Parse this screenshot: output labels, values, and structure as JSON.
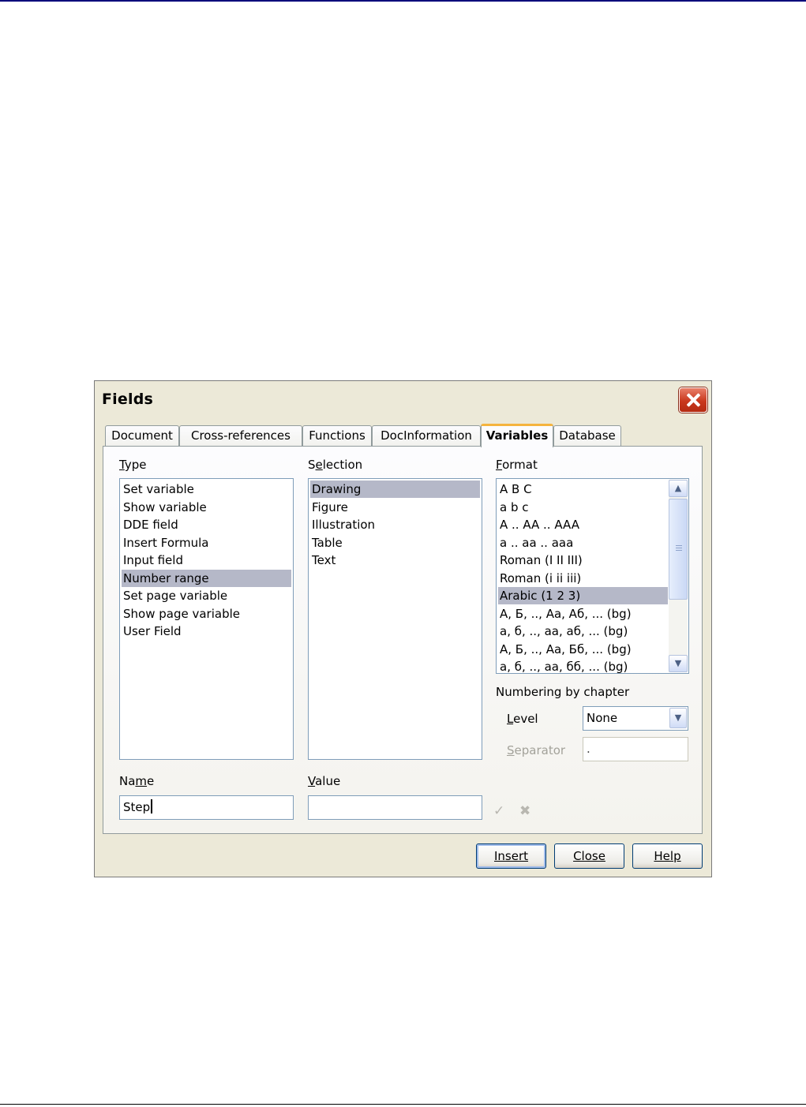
{
  "dialog": {
    "title": "Fields",
    "tabs": [
      {
        "label": "Document"
      },
      {
        "label": "Cross-references"
      },
      {
        "label": "Functions"
      },
      {
        "label": "DocInformation"
      },
      {
        "label": "Variables"
      },
      {
        "label": "Database"
      }
    ],
    "active_tab": "Variables",
    "type": {
      "label": "Type",
      "items": [
        "Set variable",
        "Show variable",
        "DDE field",
        "Insert Formula",
        "Input field",
        "Number range",
        "Set page variable",
        "Show page variable",
        "User Field"
      ],
      "selected": "Number range"
    },
    "selection": {
      "label": "Selection",
      "items": [
        "Drawing",
        "Figure",
        "Illustration",
        "Table",
        "Text"
      ],
      "selected": "Drawing"
    },
    "format": {
      "label": "Format",
      "items": [
        "A B C",
        "a b c",
        "A .. AA .. AAA",
        "a .. aa .. aaa",
        "Roman (I II III)",
        "Roman (i ii iii)",
        "Arabic (1 2 3)",
        "А, Б, .., Аа, Аб, ... (bg)",
        "а, б, .., аа, аб, ... (bg)",
        "А, Б, .., Аа, Бб, ... (bg)",
        "а, б, .., аа, бб, ... (bg)"
      ],
      "selected": "Arabic (1 2 3)"
    },
    "numbering_by_chapter": {
      "label": "Numbering by chapter",
      "level_label": "Level",
      "level_value": "None",
      "separator_label": "Separator",
      "separator_value": "."
    },
    "name": {
      "label": "Name",
      "value": "Step"
    },
    "value": {
      "label": "Value",
      "value": ""
    },
    "buttons": {
      "insert": "Insert",
      "close": "Close",
      "help": "Help"
    }
  }
}
